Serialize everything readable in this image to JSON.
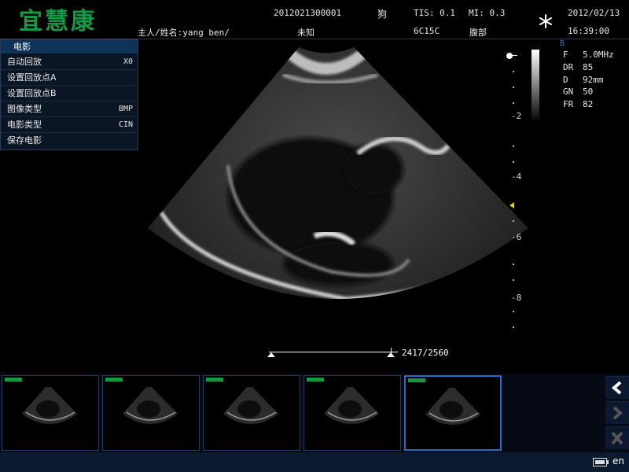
{
  "header": {
    "logo": "宜慧康",
    "patient_label": "主人/姓名:yang ben/",
    "patient_id": "2012021300001",
    "species": "狗",
    "unknown": "未知",
    "tis": "TIS: 0.1",
    "mi": "MI: 0.3",
    "probe": "6C15C",
    "exam": "腹部",
    "date": "2012/02/13",
    "time": "16:39:00"
  },
  "cine_menu": {
    "title": "电影",
    "items": [
      {
        "label": "自动回放",
        "value": "X0"
      },
      {
        "label": "设置回放点A",
        "value": ""
      },
      {
        "label": "设置回放点B",
        "value": ""
      },
      {
        "label": "图像类型",
        "value": "BMP"
      },
      {
        "label": "电影类型",
        "value": "CIN"
      },
      {
        "label": "保存电影",
        "value": ""
      }
    ]
  },
  "mode_label": "B",
  "params": [
    {
      "k": "F",
      "v": "5.0MHz"
    },
    {
      "k": "DR",
      "v": "85"
    },
    {
      "k": "D",
      "v": "92mm"
    },
    {
      "k": "GN",
      "v": "50"
    },
    {
      "k": "FR",
      "v": "82"
    }
  ],
  "depth_scale": [
    "-2",
    "-4",
    "-6",
    "-8"
  ],
  "cine": {
    "counter": "2417/2560",
    "current": 2417,
    "total": 2560
  },
  "thumbnail_count": 5,
  "selected_thumbnail": 4,
  "icons": {
    "freeze": "snowflake-icon",
    "prev": "chevron-left-icon",
    "next": "chevron-right-icon",
    "close": "close-icon",
    "battery": "battery-icon"
  },
  "footer": {
    "language": "en"
  },
  "colors": {
    "logo": "#139a43",
    "mode": "#3e72c8",
    "thumb_border": "#1f3e6b",
    "selected_border": "#2b6ac7"
  }
}
